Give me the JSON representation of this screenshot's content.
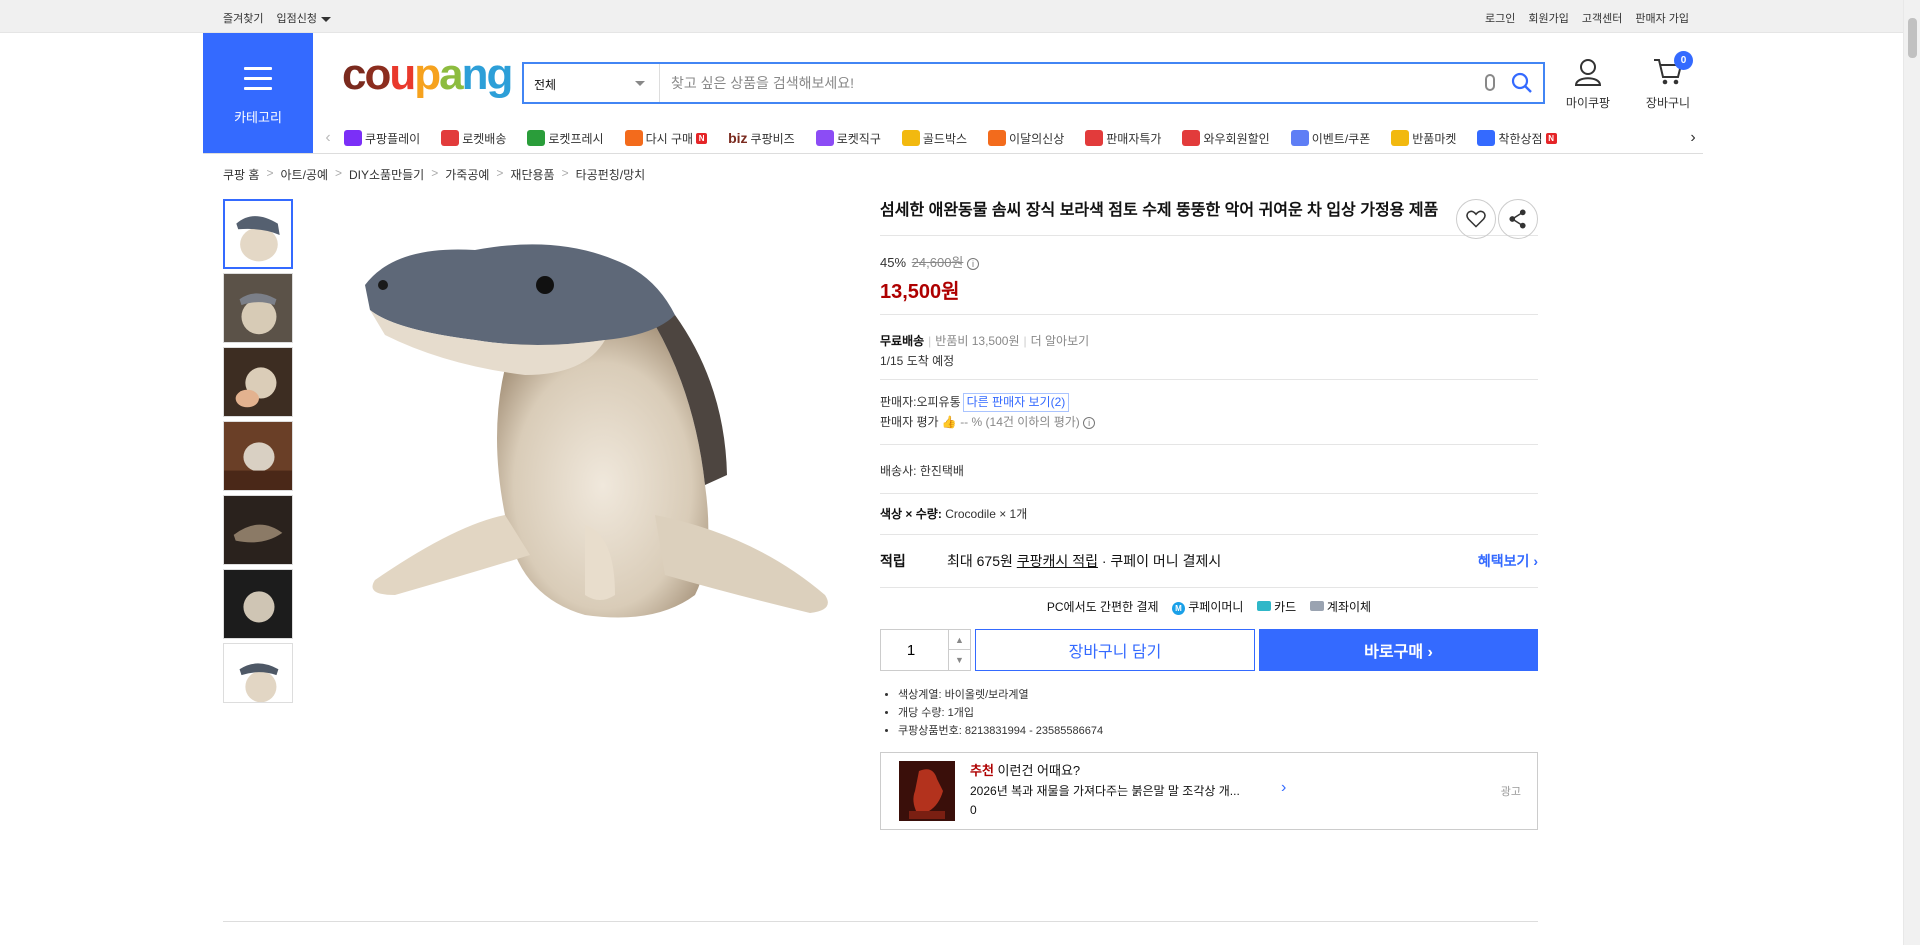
{
  "topbar": {
    "favorites": "즐겨찾기",
    "apply_store": "입점신청",
    "login": "로그인",
    "signup": "회원가입",
    "support": "고객센터",
    "seller_signup": "판매자 가입"
  },
  "header": {
    "category_label": "카테고리",
    "logo": [
      "c",
      "o",
      "u",
      "p",
      "a",
      "n",
      "g"
    ],
    "search": {
      "category": "전체",
      "placeholder": "찾고 싶은 상품을 검색해보세요!"
    },
    "my_label": "마이쿠팡",
    "cart_label": "장바구니",
    "cart_count": "0"
  },
  "nav": {
    "items": [
      {
        "label": "쿠팡플레이",
        "color": "#7b2ff7",
        "icon": "play-icon"
      },
      {
        "label": "로켓배송",
        "color": "#e23b3b",
        "icon": "rocket-icon"
      },
      {
        "label": "로켓프레시",
        "color": "#2a9d3a",
        "icon": "rocket-fresh-icon"
      },
      {
        "label": "다시 구매",
        "color": "#f36b1c",
        "icon": "repurchase-icon",
        "badge": "N"
      },
      {
        "label": "쿠팡비즈",
        "color": "#7a2a1e",
        "icon": "biz-icon",
        "prefix": "biz"
      },
      {
        "label": "로켓직구",
        "color": "#8c4cf5",
        "icon": "global-icon"
      },
      {
        "label": "골드박스",
        "color": "#f2b90f",
        "icon": "goldbox-icon"
      },
      {
        "label": "이달의신상",
        "color": "#f36b1c",
        "icon": "new-icon"
      },
      {
        "label": "판매자특가",
        "color": "#e23b3b",
        "icon": "percent-icon"
      },
      {
        "label": "와우회원할인",
        "color": "#e23b3b",
        "icon": "wow-icon"
      },
      {
        "label": "이벤트/쿠폰",
        "color": "#5e7ef5",
        "icon": "coupon-icon"
      },
      {
        "label": "반품마켓",
        "color": "#f2b90f",
        "icon": "market-icon"
      },
      {
        "label": "착한상점",
        "color": "#346aff",
        "icon": "shop-icon",
        "badge": "N"
      }
    ]
  },
  "breadcrumb": [
    "쿠팡 홈",
    "아트/공예",
    "DIY소품만들기",
    "가죽공예",
    "재단용품",
    "타공펀칭/망치"
  ],
  "product": {
    "title": "섬세한 애완동물 솜씨 장식 보라색 점토 수제 뚱뚱한 악어 귀여운 차 입상 가정용 제품",
    "discount_rate": "45%",
    "original_price": "24,600원",
    "price": "13,500원",
    "shipping_label": "무료배송",
    "return_fee": "반품비 13,500원",
    "learn_more": "더 알아보기",
    "arrival": "1/15 도착 예정",
    "seller_label": "판매자:",
    "seller_name": "오피유통",
    "other_sellers": "다른 판매자 보기(2)",
    "seller_rating_label": "판매자 평가",
    "seller_rating_value": "-- %",
    "seller_rating_note": "(14건 이하의 평가)",
    "courier_label": "배송사:",
    "courier": "한진택배",
    "option_label": "색상 × 수량:",
    "option_value": "Crocodile × 1개",
    "reward_label": "적립",
    "reward_text_1": "최대 675원",
    "reward_text_2": "쿠팡캐시 적립",
    "reward_text_3": "· 쿠페이 머니 결제시",
    "reward_more": "혜택보기",
    "pay_title": "PC에서도 간편한 결제",
    "pay_methods": [
      "쿠페이머니",
      "카드",
      "계좌이체"
    ],
    "quantity": "1",
    "add_to_cart": "장바구니 담기",
    "buy_now": "바로구매",
    "attributes": [
      "색상계열: 바이올렛/보라계열",
      "개당 수량: 1개입",
      "쿠팡상품번호: 8213831994 - 23585586674"
    ]
  },
  "recommend": {
    "title_em": "추천",
    "title": "이런건 어때요?",
    "item": "2026년 복과 재물을 가져다주는 붉은말 말 조각상 개...",
    "count": "0",
    "ad": "광고"
  }
}
